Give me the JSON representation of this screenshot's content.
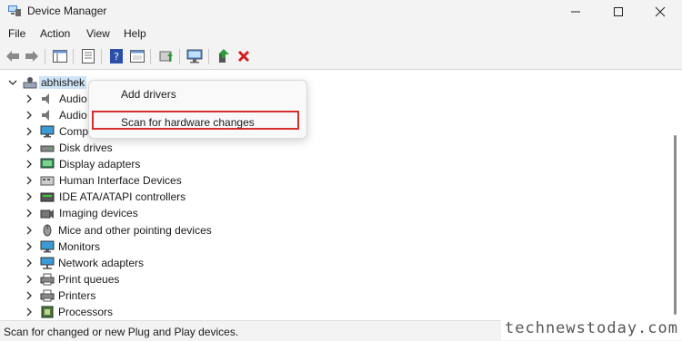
{
  "window": {
    "title": "Device Manager",
    "controls": {
      "minimize": "minimize",
      "maximize": "maximize",
      "close": "close"
    }
  },
  "menu": [
    "File",
    "Action",
    "View",
    "Help"
  ],
  "toolbar": {
    "icons": [
      "back-arrow-icon",
      "forward-arrow-icon",
      "show-hide-console-tree-icon",
      "properties-icon",
      "help-icon",
      "action-pane-icon",
      "update-driver-icon",
      "scan-hardware-icon",
      "enable-device-icon",
      "uninstall-device-icon"
    ]
  },
  "tree": {
    "root": "abhishek",
    "items": [
      "Audio",
      "Audio",
      "Comp",
      "Disk drives",
      "Display adapters",
      "Human Interface Devices",
      "IDE ATA/ATAPI controllers",
      "Imaging devices",
      "Mice and other pointing devices",
      "Monitors",
      "Network adapters",
      "Print queues",
      "Printers",
      "Processors"
    ]
  },
  "context_menu": {
    "items": [
      "Add drivers",
      "Scan for hardware changes"
    ],
    "highlight_color": "#d62d2d"
  },
  "status": "Scan for changed or new Plug and Play devices.",
  "watermark": "technewstoday.com",
  "colors": {
    "selection": "#cfe4f7",
    "uninstall_red": "#d21f1f",
    "update_green": "#2f9a3a"
  }
}
